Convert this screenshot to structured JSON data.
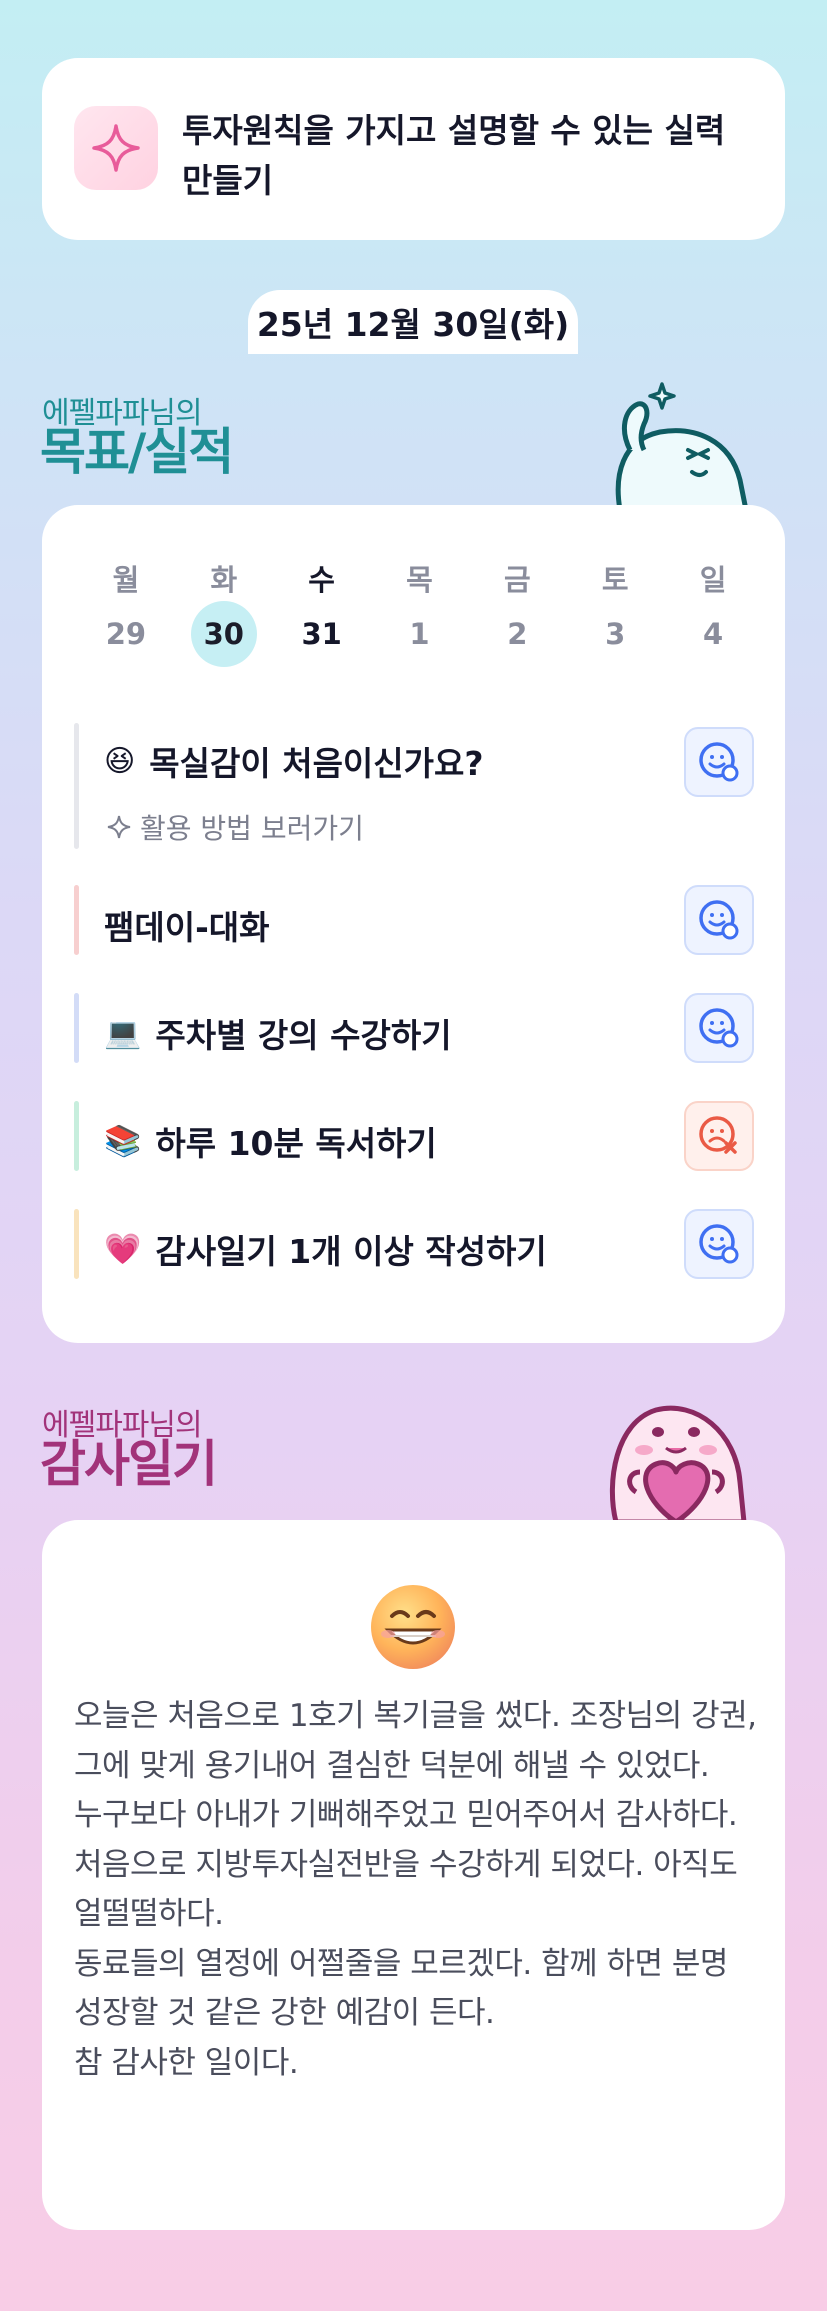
{
  "goal": {
    "icon": "sparkle-icon",
    "text": "투자원칙을 가지고 설명할 수 있는 실력 만들기"
  },
  "date": "25년 12월 30일(화)",
  "goals_section": {
    "subtitle": "에펠파파님의",
    "title": "목표/실적"
  },
  "calendar": {
    "weekdays": [
      "월",
      "화",
      "수",
      "목",
      "금",
      "토",
      "일"
    ],
    "dates": [
      "29",
      "30",
      "31",
      "1",
      "2",
      "3",
      "4"
    ],
    "selected_index": 1
  },
  "tasks": [
    {
      "emoji": "😆",
      "title": "목실감이 처음이신가요?",
      "link": "활용 방법 보러가기",
      "bar_color": "#e6e7ec",
      "status": "smile-icon",
      "status_color": "#3f6ff2"
    },
    {
      "emoji": "",
      "title": "팸데이-대화",
      "bar_color": "#f7cfcf",
      "status": "smile-icon",
      "status_color": "#3f6ff2"
    },
    {
      "emoji": "💻",
      "title": "주차별 강의 수강하기",
      "bar_color": "#d3dcf7",
      "status": "smile-icon",
      "status_color": "#3f6ff2"
    },
    {
      "emoji": "📚",
      "title": "하루 10분 독서하기",
      "bar_color": "#c7eedd",
      "status": "sad-icon",
      "status_color": "#ea5a45"
    },
    {
      "emoji": "💗",
      "title": "감사일기 1개 이상 작성하기",
      "bar_color": "#f9e3bd",
      "status": "smile-icon",
      "status_color": "#3f6ff2"
    }
  ],
  "diary_section": {
    "subtitle": "에펠파파님의",
    "title": "감사일기"
  },
  "diary": {
    "emoji": "grinning-face-icon",
    "lines": [
      "오늘은 처음으로 1호기 복기글을 썼다. 조장님의 강권, 그에 맞게 용기내어 결심한 덕분에 해낼 수 있었다.",
      "누구보다 아내가 기뻐해주었고 믿어주어서 감사하다.",
      "처음으로 지방투자실전반을 수강하게 되었다. 아직도 얼떨떨하다.",
      "동료들의 열정에 어쩔줄을 모르겠다. 함께 하면 분명 성장할 것 같은 강한 예감이 든다.",
      "참 감사한 일이다."
    ]
  },
  "colors": {
    "goal_title": "#1f8f95",
    "diary_title": "#a2337a",
    "accent_blue": "#3f6ff2",
    "accent_red": "#ea5a45"
  }
}
